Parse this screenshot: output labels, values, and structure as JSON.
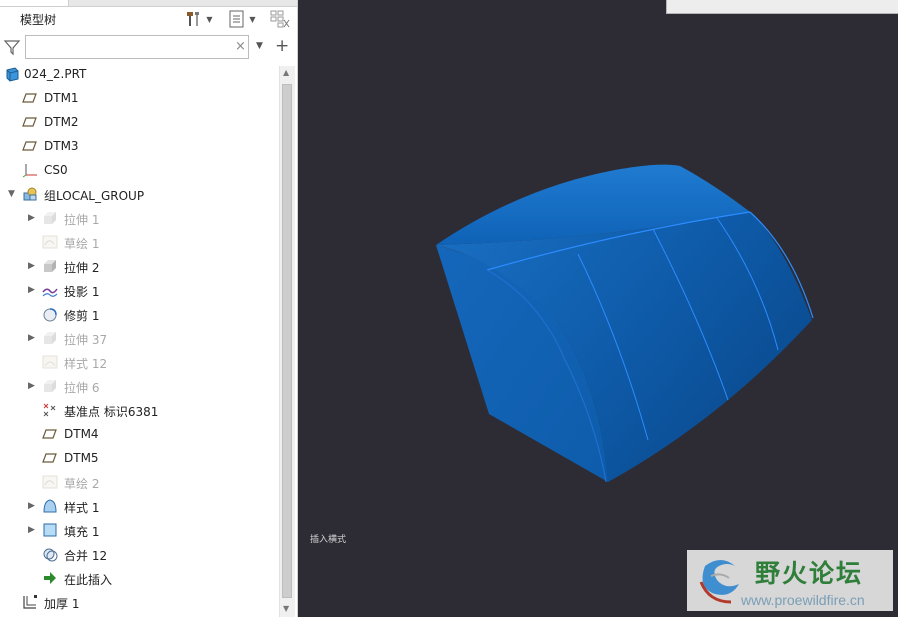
{
  "panel": {
    "title": "模型树",
    "search": {
      "value": "",
      "placeholder": ""
    },
    "clear_symbol": "×",
    "add_symbol": "+"
  },
  "tree": [
    {
      "label": "024_2.PRT",
      "icon": "part-icon",
      "level": 0,
      "expander": "none",
      "dim": false
    },
    {
      "label": "DTM1",
      "icon": "datum-plane-icon",
      "level": 1,
      "expander": "none",
      "dim": false
    },
    {
      "label": "DTM2",
      "icon": "datum-plane-icon",
      "level": 1,
      "expander": "none",
      "dim": false
    },
    {
      "label": "DTM3",
      "icon": "datum-plane-icon",
      "level": 1,
      "expander": "none",
      "dim": false
    },
    {
      "label": "CS0",
      "icon": "coordinate-system-icon",
      "level": 1,
      "expander": "none",
      "dim": false
    },
    {
      "label": "组LOCAL_GROUP",
      "icon": "group-icon",
      "level": 1,
      "expander": "open",
      "dim": false
    },
    {
      "label": "拉伸 1",
      "icon": "extrude-icon",
      "level": 2,
      "expander": "closed",
      "dim": true
    },
    {
      "label": "草绘 1",
      "icon": "sketch-icon",
      "level": 2,
      "expander": "none",
      "dim": true
    },
    {
      "label": "拉伸 2",
      "icon": "extrude-icon",
      "level": 2,
      "expander": "closed",
      "dim": false
    },
    {
      "label": "投影 1",
      "icon": "projection-icon",
      "level": 2,
      "expander": "closed",
      "dim": false
    },
    {
      "label": "修剪 1",
      "icon": "trim-icon",
      "level": 2,
      "expander": "none",
      "dim": false
    },
    {
      "label": "拉伸 37",
      "icon": "extrude-icon",
      "level": 2,
      "expander": "closed",
      "dim": true
    },
    {
      "label": "样式 12",
      "icon": "style-icon",
      "level": 2,
      "expander": "none",
      "dim": true
    },
    {
      "label": "拉伸 6",
      "icon": "extrude-icon",
      "level": 2,
      "expander": "closed",
      "dim": true
    },
    {
      "label": "基准点 标识6381",
      "icon": "datum-point-icon",
      "level": 2,
      "expander": "none",
      "dim": false
    },
    {
      "label": "DTM4",
      "icon": "datum-plane-icon",
      "level": 2,
      "expander": "none",
      "dim": false
    },
    {
      "label": "DTM5",
      "icon": "datum-plane-icon",
      "level": 2,
      "expander": "none",
      "dim": false
    },
    {
      "label": "草绘 2",
      "icon": "sketch-icon",
      "level": 2,
      "expander": "none",
      "dim": true
    },
    {
      "label": "样式 1",
      "icon": "style-surface-icon",
      "level": 2,
      "expander": "closed",
      "dim": false
    },
    {
      "label": "填充 1",
      "icon": "fill-icon",
      "level": 2,
      "expander": "closed",
      "dim": false
    },
    {
      "label": "合并 12",
      "icon": "merge-icon",
      "level": 2,
      "expander": "none",
      "dim": false
    },
    {
      "label": "在此插入",
      "icon": "insert-here-icon",
      "level": 2,
      "expander": "none",
      "dim": false
    },
    {
      "label": "加厚 1",
      "icon": "thicken-icon",
      "level": 1,
      "expander": "none",
      "dim": false
    }
  ],
  "viewport": {
    "status": "插入横式",
    "background": "#2d2c35",
    "model_color": "#1464b2",
    "edge_color": "#2c8cff"
  },
  "watermark": {
    "cn": "野火论坛",
    "url": "www.proewildfire.cn"
  }
}
